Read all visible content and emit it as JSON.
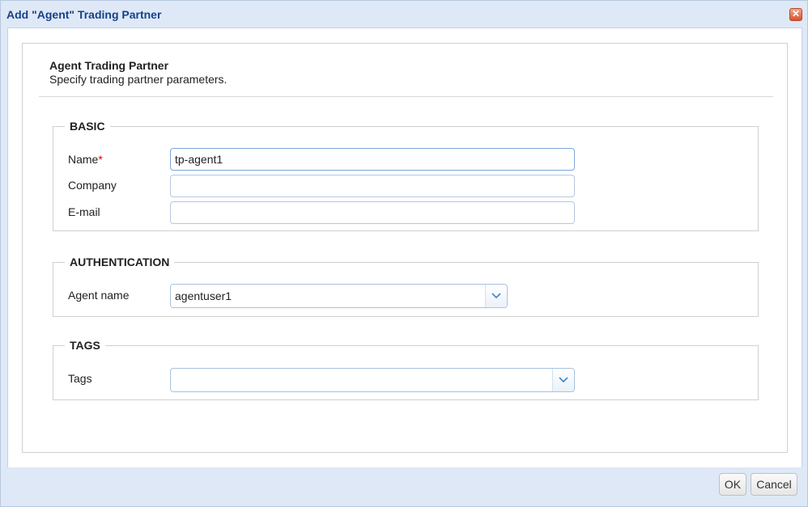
{
  "window": {
    "title": "Add \"Agent\" Trading Partner",
    "close_glyph": "✕"
  },
  "panel": {
    "title": "Agent Trading Partner",
    "subtitle": "Specify trading partner parameters."
  },
  "basic": {
    "legend": "BASIC",
    "name_label": "Name",
    "required_mark": "*",
    "name_value": "tp-agent1",
    "company_label": "Company",
    "company_value": "",
    "email_label": "E-mail",
    "email_value": ""
  },
  "authentication": {
    "legend": "AUTHENTICATION",
    "agent_name_label": "Agent name",
    "agent_name_value": "agentuser1"
  },
  "tags": {
    "legend": "TAGS",
    "tags_label": "Tags",
    "tags_value": ""
  },
  "footer": {
    "ok_label": "OK",
    "cancel_label": "Cancel"
  },
  "icons": {
    "close": "close-icon",
    "dropdown": "chevron-down-icon"
  }
}
